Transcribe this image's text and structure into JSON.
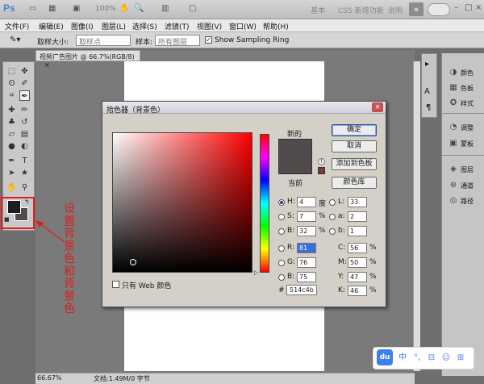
{
  "app": {
    "logo": "Ps",
    "zoom_indicator": "100%",
    "workspaces": [
      "基本",
      "CSS 新增功能",
      "说明"
    ],
    "more": "»"
  },
  "menus": [
    "文件(F)",
    "编辑(E)",
    "图像(I)",
    "图层(L)",
    "选择(S)",
    "滤镜(T)",
    "视图(V)",
    "窗口(W)",
    "帮助(H)"
  ],
  "options_bar": {
    "sample_size_label": "取样大小:",
    "sample_size_value": "取样点",
    "sample_label": "样本:",
    "sample_value": "所有图层",
    "ring_label": "Show Sampling Ring",
    "ring_checked": "✓"
  },
  "document": {
    "tab_title": "视频广告图片 @ 66.7%(RGB/8)",
    "tab_close": "×",
    "zoom": "66.67%",
    "info": "文档:1.49M/0 字节"
  },
  "panels": [
    {
      "label": "颜色",
      "icon": "color-icon"
    },
    {
      "label": "色板",
      "icon": "swatches-icon"
    },
    {
      "label": "样式",
      "icon": "styles-icon"
    },
    {
      "label": "调整",
      "icon": "adjustments-icon"
    },
    {
      "label": "蒙板",
      "icon": "masks-icon"
    },
    {
      "label": "图层",
      "icon": "layers-icon"
    },
    {
      "label": "通道",
      "icon": "channels-icon"
    },
    {
      "label": "路径",
      "icon": "paths-icon"
    }
  ],
  "annotation": {
    "text": "设置背景色和背景色",
    "color": "#d62020"
  },
  "color_picker": {
    "title": "拾色器（背景色）",
    "close": "×",
    "new_label": "新的",
    "current_label": "当前",
    "buttons": {
      "ok": "确定",
      "cancel": "取消",
      "add_swatch": "添加到色板",
      "libraries": "颜色库"
    },
    "hsb": [
      {
        "label": "H:",
        "value": "4",
        "unit": "度",
        "selected": true
      },
      {
        "label": "S:",
        "value": "7",
        "unit": "%"
      },
      {
        "label": "B:",
        "value": "32",
        "unit": "%"
      }
    ],
    "rgb": [
      {
        "label": "R:",
        "value": "81"
      },
      {
        "label": "G:",
        "value": "76"
      },
      {
        "label": "B:",
        "value": "75"
      }
    ],
    "lab": [
      {
        "label": "L:",
        "value": "33"
      },
      {
        "label": "a:",
        "value": "2"
      },
      {
        "label": "b:",
        "value": "1"
      }
    ],
    "cmyk": [
      {
        "label": "C:",
        "value": "56",
        "unit": "%"
      },
      {
        "label": "M:",
        "value": "50",
        "unit": "%"
      },
      {
        "label": "Y:",
        "value": "47",
        "unit": "%"
      },
      {
        "label": "K:",
        "value": "46",
        "unit": "%"
      }
    ],
    "hex_label": "#",
    "hex": "514c4b",
    "web_only_label": "只有 Web 颜色",
    "color": "#514c4b"
  },
  "du_toolbar": {
    "logo": "du",
    "items": [
      "中",
      "°,",
      "⊟",
      "☺",
      "⊞"
    ]
  }
}
